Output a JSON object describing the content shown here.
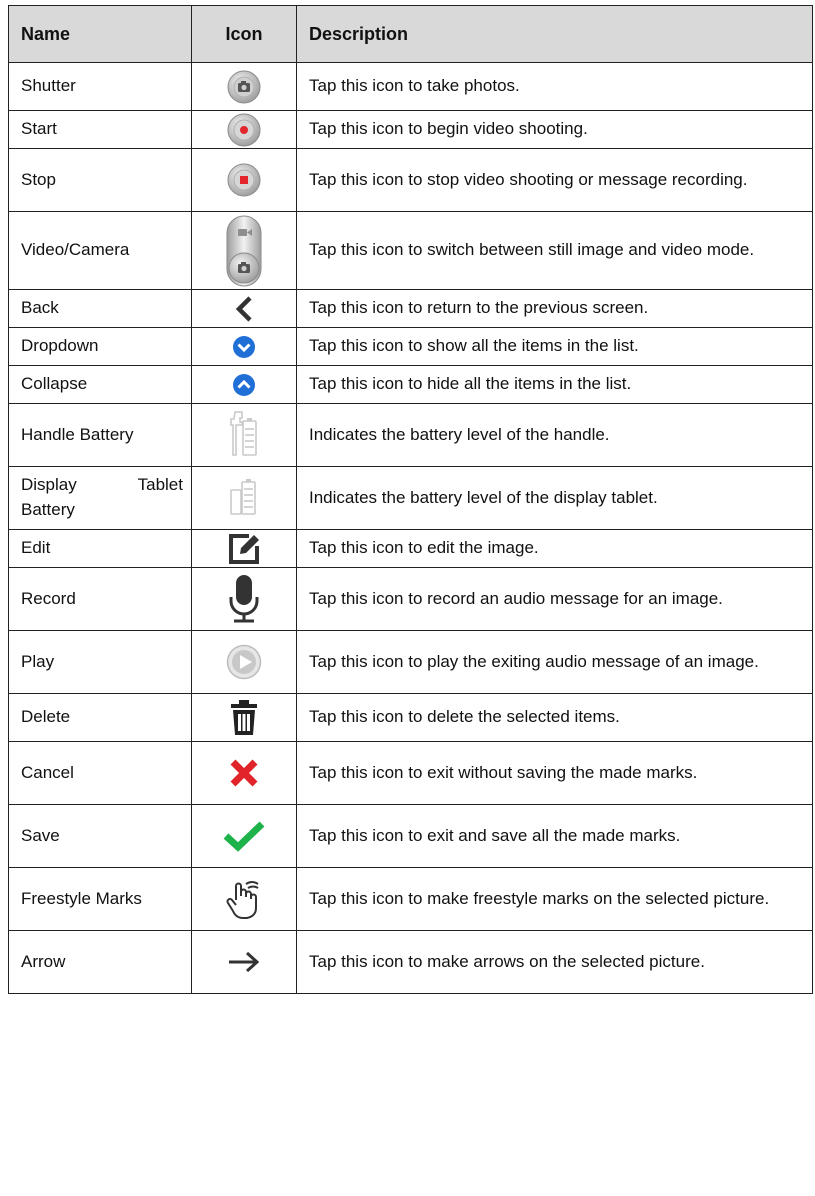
{
  "header": {
    "name": "Name",
    "icon": "Icon",
    "description": "Description"
  },
  "rows": [
    {
      "name": "Shutter",
      "icon": "shutter-icon",
      "description": "Tap this icon to take photos."
    },
    {
      "name": "Start",
      "icon": "start-record-icon",
      "description": "Tap this icon to begin video shooting."
    },
    {
      "name": "Stop",
      "icon": "stop-record-icon",
      "description": "Tap this icon to stop video shooting or message recording."
    },
    {
      "name": "Video/Camera",
      "icon": "video-camera-toggle-icon",
      "description": "Tap this icon to switch between still image and video mode."
    },
    {
      "name": "Back",
      "icon": "back-chevron-icon",
      "description": "Tap this icon to return to the previous screen."
    },
    {
      "name": "Dropdown",
      "icon": "dropdown-icon",
      "description": "Tap this icon to show all the items in the list."
    },
    {
      "name": "Collapse",
      "icon": "collapse-icon",
      "description": "Tap this icon to hide all the items in the list."
    },
    {
      "name": "Handle Battery",
      "icon": "handle-battery-icon",
      "description": "Indicates the battery level of the handle."
    },
    {
      "name": "Display Tablet Battery",
      "icon": "tablet-battery-icon",
      "description": "Indicates the battery level of the display tablet."
    },
    {
      "name": "Edit",
      "icon": "edit-icon",
      "description": "Tap this icon to edit the image."
    },
    {
      "name": "Record",
      "icon": "microphone-icon",
      "description": "Tap this icon to record an audio message for an image."
    },
    {
      "name": "Play",
      "icon": "play-icon",
      "description": "Tap this icon to play the exiting audio message of an image."
    },
    {
      "name": "Delete",
      "icon": "trash-icon",
      "description": "Tap this icon to delete the selected items."
    },
    {
      "name": "Cancel",
      "icon": "cancel-x-icon",
      "description": "Tap this icon to exit without saving the made marks."
    },
    {
      "name": "Save",
      "icon": "save-check-icon",
      "description": "Tap this icon to exit and save all the made marks."
    },
    {
      "name": "Freestyle Marks",
      "icon": "freestyle-hand-icon",
      "description": "Tap this icon to make freestyle marks on the selected picture."
    },
    {
      "name": "Arrow",
      "icon": "arrow-right-icon",
      "description": "Tap this icon to make arrows on the selected picture."
    }
  ],
  "colors": {
    "header_bg": "#d9d9d9",
    "record_red": "#e3262b",
    "chevron_blue": "#1f6fd6",
    "cancel_red": "#e0242a",
    "save_green": "#1eb24a"
  }
}
